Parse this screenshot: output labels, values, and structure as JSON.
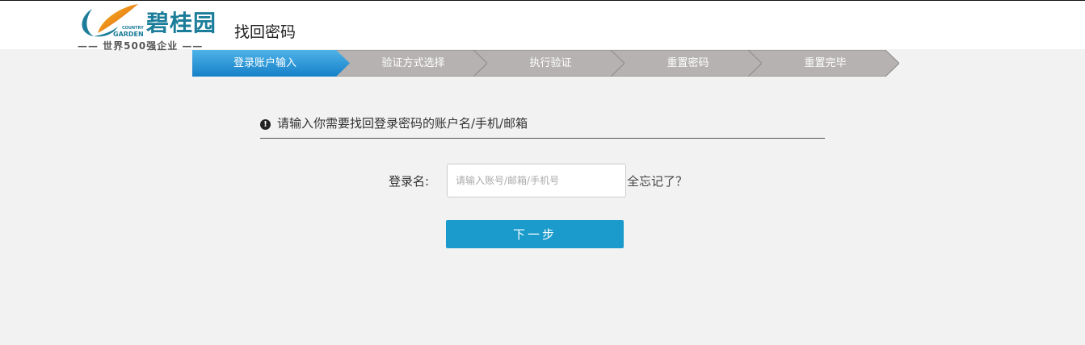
{
  "header": {
    "brand": "碧桂园",
    "brand_en_1": "COUNTRY",
    "brand_en_2": "GARDEN",
    "slogan": "—— 世界500强企业 ——",
    "page_title": "找回密码"
  },
  "steps": [
    {
      "label": "登录账户输入",
      "active": true
    },
    {
      "label": "验证方式选择",
      "active": false
    },
    {
      "label": "执行验证",
      "active": false
    },
    {
      "label": "重置密码",
      "active": false
    },
    {
      "label": "重置完毕",
      "active": false
    }
  ],
  "colors": {
    "active_step": "#1a8fd6",
    "inactive_step": "#b5b2b1",
    "button": "#1a9bcb"
  },
  "form": {
    "notice": "请输入你需要找回登录密码的账户名/手机/邮箱",
    "notice_icon": "!",
    "login_label": "登录名:",
    "login_value": "",
    "login_placeholder": "请输入账号/邮箱/手机号",
    "forgot": "全忘记了？",
    "next": "下一步"
  }
}
